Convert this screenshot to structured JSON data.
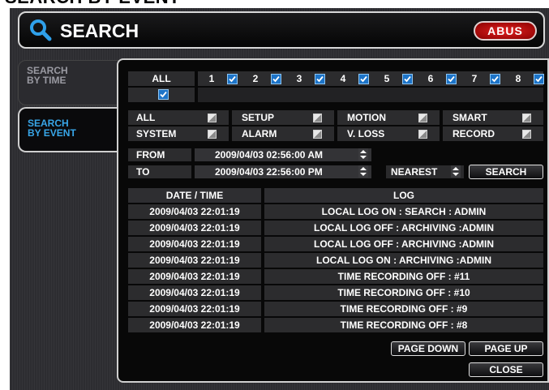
{
  "page_title": "SEARCH BY EVENT",
  "header": {
    "title": "SEARCH",
    "logo_text": "ABUS"
  },
  "tabs": [
    {
      "label_line1": "SEARCH",
      "label_line2": "BY TIME",
      "active": false
    },
    {
      "label_line1": "SEARCH",
      "label_line2": "BY EVENT",
      "active": true
    }
  ],
  "channels": {
    "all_label": "ALL",
    "all_checked": true,
    "items": [
      {
        "label": "1",
        "checked": true
      },
      {
        "label": "2",
        "checked": true
      },
      {
        "label": "3",
        "checked": true
      },
      {
        "label": "4",
        "checked": true
      },
      {
        "label": "5",
        "checked": true
      },
      {
        "label": "6",
        "checked": true
      },
      {
        "label": "7",
        "checked": true
      },
      {
        "label": "8",
        "checked": true
      }
    ]
  },
  "event_types": {
    "row1": [
      "ALL",
      "SETUP",
      "MOTION",
      "SMART"
    ],
    "row2": [
      "SYSTEM",
      "ALARM",
      "V. LOSS",
      "RECORD"
    ]
  },
  "range": {
    "from_label": "FROM",
    "from_value": "2009/04/03 02:56:00 AM",
    "to_label": "TO",
    "to_value": "2009/04/03 22:56:00 PM",
    "nearest_label": "NEAREST",
    "search_button": "SEARCH"
  },
  "table": {
    "col_datetime": "DATE / TIME",
    "col_log": "LOG",
    "rows": [
      {
        "datetime": "2009/04/03  22:01:19",
        "log": "LOCAL LOG ON : SEARCH : ADMIN"
      },
      {
        "datetime": "2009/04/03  22:01:19",
        "log": "LOCAL LOG OFF : ARCHIVING :ADMIN"
      },
      {
        "datetime": "2009/04/03  22:01:19",
        "log": "LOCAL LOG OFF : ARCHIVING :ADMIN"
      },
      {
        "datetime": "2009/04/03  22:01:19",
        "log": "LOCAL LOG ON : ARCHIVING :ADMIN"
      },
      {
        "datetime": "2009/04/03  22:01:19",
        "log": "TIME RECORDING OFF : #11"
      },
      {
        "datetime": "2009/04/03  22:01:19",
        "log": "TIME RECORDING OFF : #10"
      },
      {
        "datetime": "2009/04/03  22:01:19",
        "log": "TIME RECORDING OFF : #9"
      },
      {
        "datetime": "2009/04/03  22:01:19",
        "log": "TIME RECORDING OFF : #8"
      }
    ]
  },
  "buttons": {
    "page_down": "PAGE DOWN",
    "page_up": "PAGE UP",
    "close": "CLOSE"
  },
  "colors": {
    "accent_blue": "#38a6e8",
    "checkbox_blue": "#1d74c8",
    "logo_red": "#d01818",
    "panel_bg": "#080808"
  }
}
